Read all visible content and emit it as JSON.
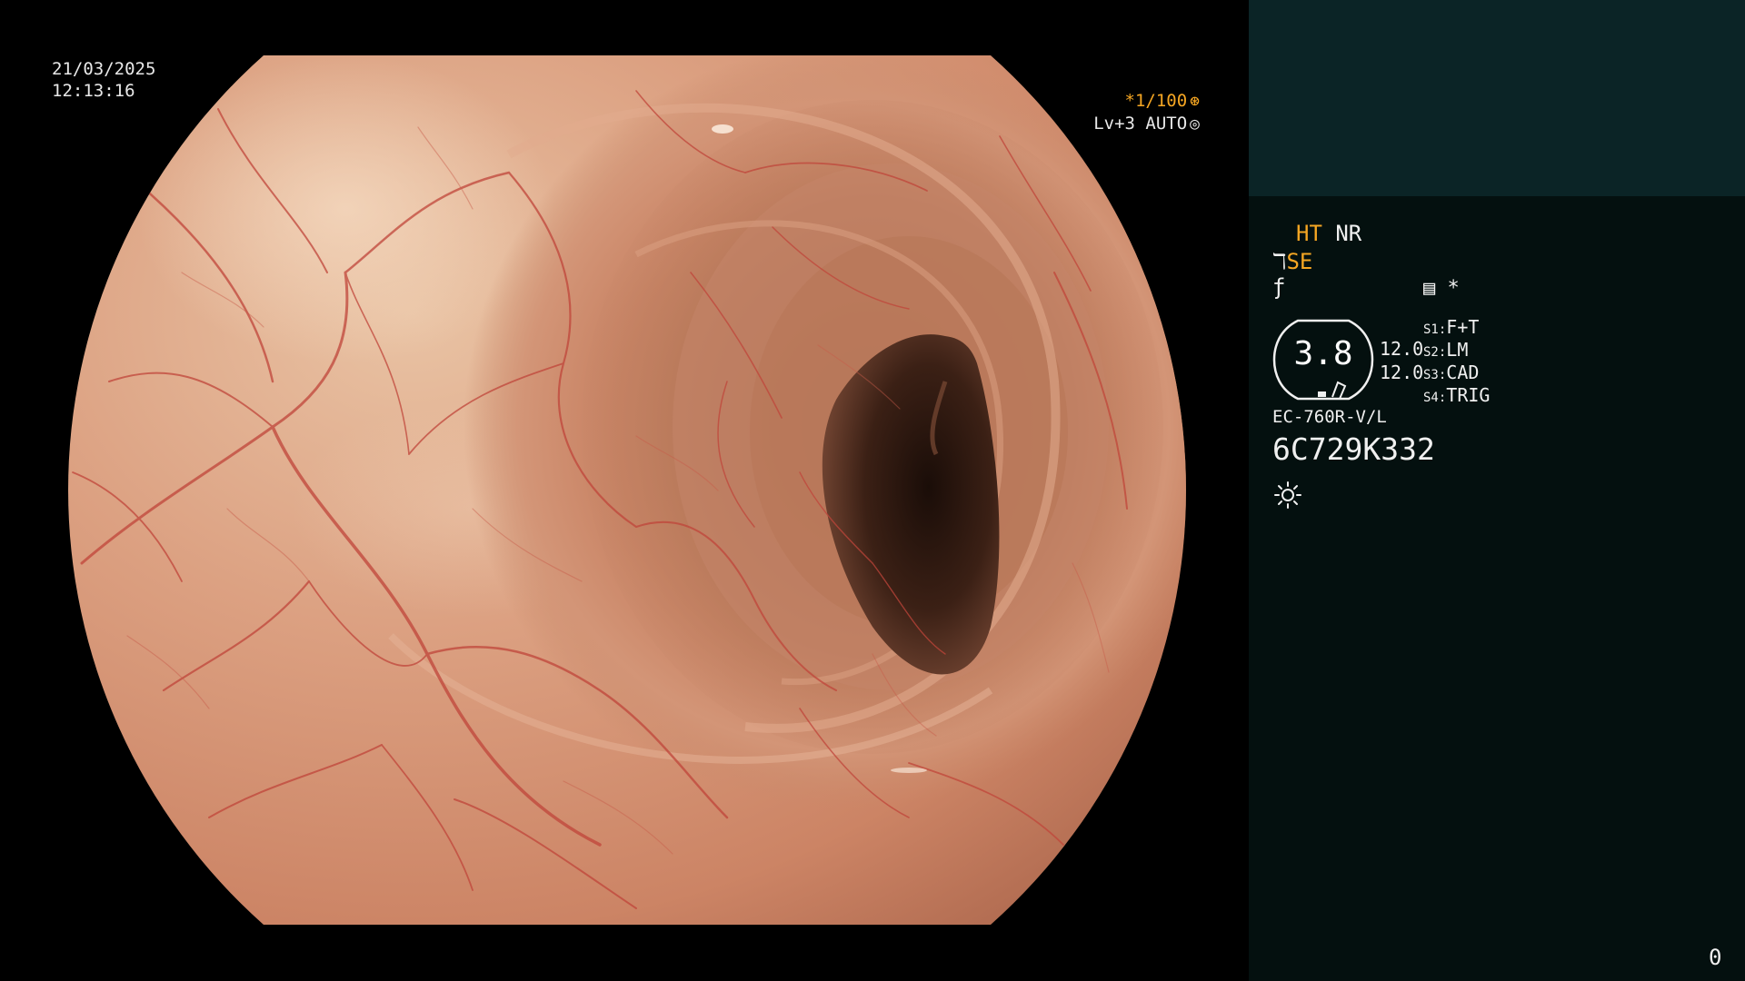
{
  "overlay": {
    "date": "21/03/2025",
    "time": "12:13:16",
    "shutter": "*1/100",
    "shutter_icon": "aperture-icon",
    "level": "Lv+3 AUTO",
    "level_icon": "iris-icon"
  },
  "panel": {
    "ht": "HT",
    "nr": "NR",
    "se": "SE",
    "se_icon": "scope-tip-icon",
    "f_icon": "f-curve-icon",
    "memo_icon": "memo-icon",
    "memo_mark": "*",
    "gauge_value": "3.8",
    "scale_1": "12.0",
    "scale_2": "12.0",
    "switches": [
      {
        "key": "S1:",
        "value": "F+T"
      },
      {
        "key": "S2:",
        "value": "LM"
      },
      {
        "key": "S3:",
        "value": "CAD"
      },
      {
        "key": "S4:",
        "value": "TRIG"
      }
    ],
    "scope_model": "EC-760R-V/L",
    "scope_serial": "6C729K332",
    "brightness_icon": "sun-icon",
    "frame_counter": "0"
  },
  "colors": {
    "accent": "#f5a623",
    "panel_bg": "#04100f",
    "panel_header": "#0b2426",
    "mucosa": "#d9967a",
    "vessel": "#c0453a",
    "lumen": "#2a160e"
  }
}
